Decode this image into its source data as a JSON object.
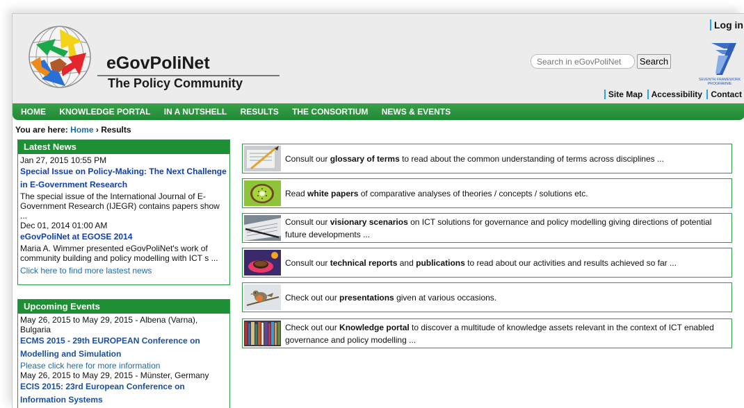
{
  "header": {
    "title": "eGovPoliNet",
    "subtitle": "The Policy Community",
    "login_label": "Log in",
    "search_placeholder": "Search in eGovPoliNet",
    "search_button": "Search",
    "fp7_text": "SEVENTH FRAMEWORK PROGRAMME",
    "util_links": [
      "Site Map",
      "Accessibility",
      "Contact"
    ]
  },
  "nav": {
    "items": [
      "HOME",
      "KNOWLEDGE PORTAL",
      "IN A NUTSHELL",
      "RESULTS",
      "THE CONSORTIUM",
      "NEWS & EVENTS"
    ]
  },
  "breadcrumb": {
    "prefix": "You are here:",
    "home": "Home",
    "separator": "›",
    "current": "Results"
  },
  "news": {
    "heading": "Latest News",
    "items": [
      {
        "date": "Jan 27, 2015 10:55 PM",
        "title": "Special Issue on Policy-Making: The Next Challenge in E-Government Research",
        "text": "The special issue of the International Journal of E-Government Research (IJEGR) contains papers show ..."
      },
      {
        "date": "Dec 01, 2014 01:00 AM",
        "title": "eGovPoliNet at EGOSE 2014",
        "text": "Maria A. Wimmer presented eGovPoliNet's work of community building and policy modelling with ICT s ..."
      }
    ],
    "more_link": "Click here to find more lastest news"
  },
  "events": {
    "heading": "Upcoming Events",
    "items": [
      {
        "date_place": "May 26, 2015 to May 29, 2015 - Albena (Varna), Bulgaria",
        "title": "ECMS 2015 - 29th EUROPEAN Conference on Modelling and Simulation",
        "link": "Please click here for more information"
      },
      {
        "date_place": "May 26, 2015 to May 29, 2015 - Münster, Germany",
        "title": "ECIS 2015: 23rd European Conference on Information Systems"
      }
    ]
  },
  "results": [
    {
      "pre": "Consult our ",
      "bold": "glossary of terms",
      "post": " to read about the common understanding of terms across disciplines ..."
    },
    {
      "pre": "Read ",
      "bold": "white papers",
      "post": " of comparative analyses of theories / concepts / solutions etc."
    },
    {
      "pre": "Consult our ",
      "bold": "visionary scenarios",
      "post": " on ICT solutions for governance and policy modelling giving directions of potential future developments ..."
    },
    {
      "pre": "Consult our ",
      "bold": "technical reports",
      "mid": " and ",
      "bold2": "publications",
      "post": " to read about our activities and results achieved so far ..."
    },
    {
      "pre": "Check out our ",
      "bold": "presentations",
      "post": " given at various occasions."
    },
    {
      "pre": "Check out our ",
      "bold": "Knowledge portal",
      "post": " to discover a multitude of knowledge assets relevant in the context of ICT enabled governance and policy modelling ..."
    }
  ],
  "colors": {
    "nav_green": "#1f8a34",
    "link_blue": "#1e6aa8",
    "title_blue": "#0f3fb0",
    "divider_blue": "#2aa3e8",
    "header_bg": "#ececec"
  },
  "icons": [
    "globe-logo-icon",
    "fp7-logo-icon",
    "glossary-thumb",
    "kiwi-thumb",
    "pen-paper-thumb",
    "coffee-thumb",
    "bird-thumb",
    "books-thumb"
  ]
}
